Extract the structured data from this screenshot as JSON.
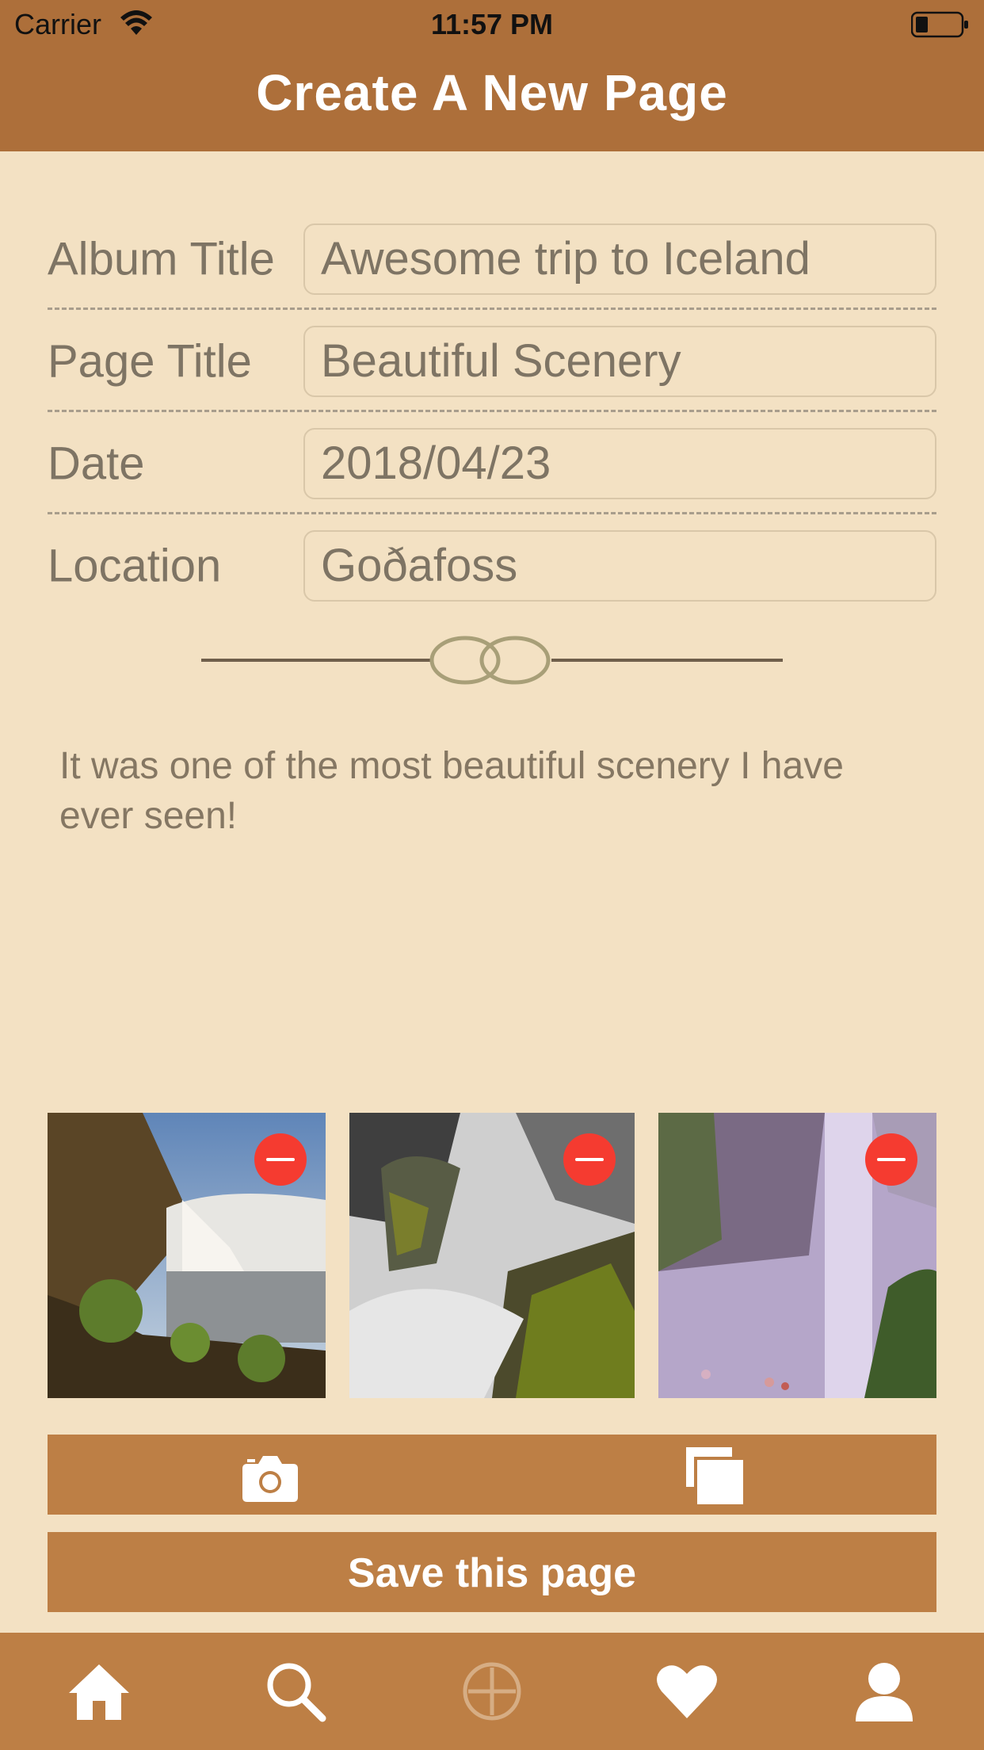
{
  "status_bar": {
    "carrier": "Carrier",
    "time": "11:57 PM"
  },
  "header": {
    "title": "Create A New Page"
  },
  "form": {
    "album_title": {
      "label": "Album Title",
      "value": "Awesome trip to Iceland"
    },
    "page_title": {
      "label": "Page Title",
      "value": "Beautiful Scenery"
    },
    "date": {
      "label": "Date",
      "value": "2018/04/23"
    },
    "location": {
      "label": "Location",
      "value": "Goðafoss"
    }
  },
  "description": "It was one of the most beautiful scenery I have ever seen!",
  "photos": [
    {
      "icon": "remove-icon"
    },
    {
      "icon": "remove-icon"
    },
    {
      "icon": "remove-icon"
    }
  ],
  "actions": {
    "camera_icon": "camera-icon",
    "library_icon": "photo-library-icon",
    "save_label": "Save this page"
  },
  "tabbar": {
    "items": [
      "home-icon",
      "search-icon",
      "add-icon",
      "heart-icon",
      "profile-icon"
    ]
  },
  "colors": {
    "header": "#ad6f3a",
    "background": "#f3e1c3",
    "button": "#bd7f45",
    "remove": "#f53b30"
  }
}
